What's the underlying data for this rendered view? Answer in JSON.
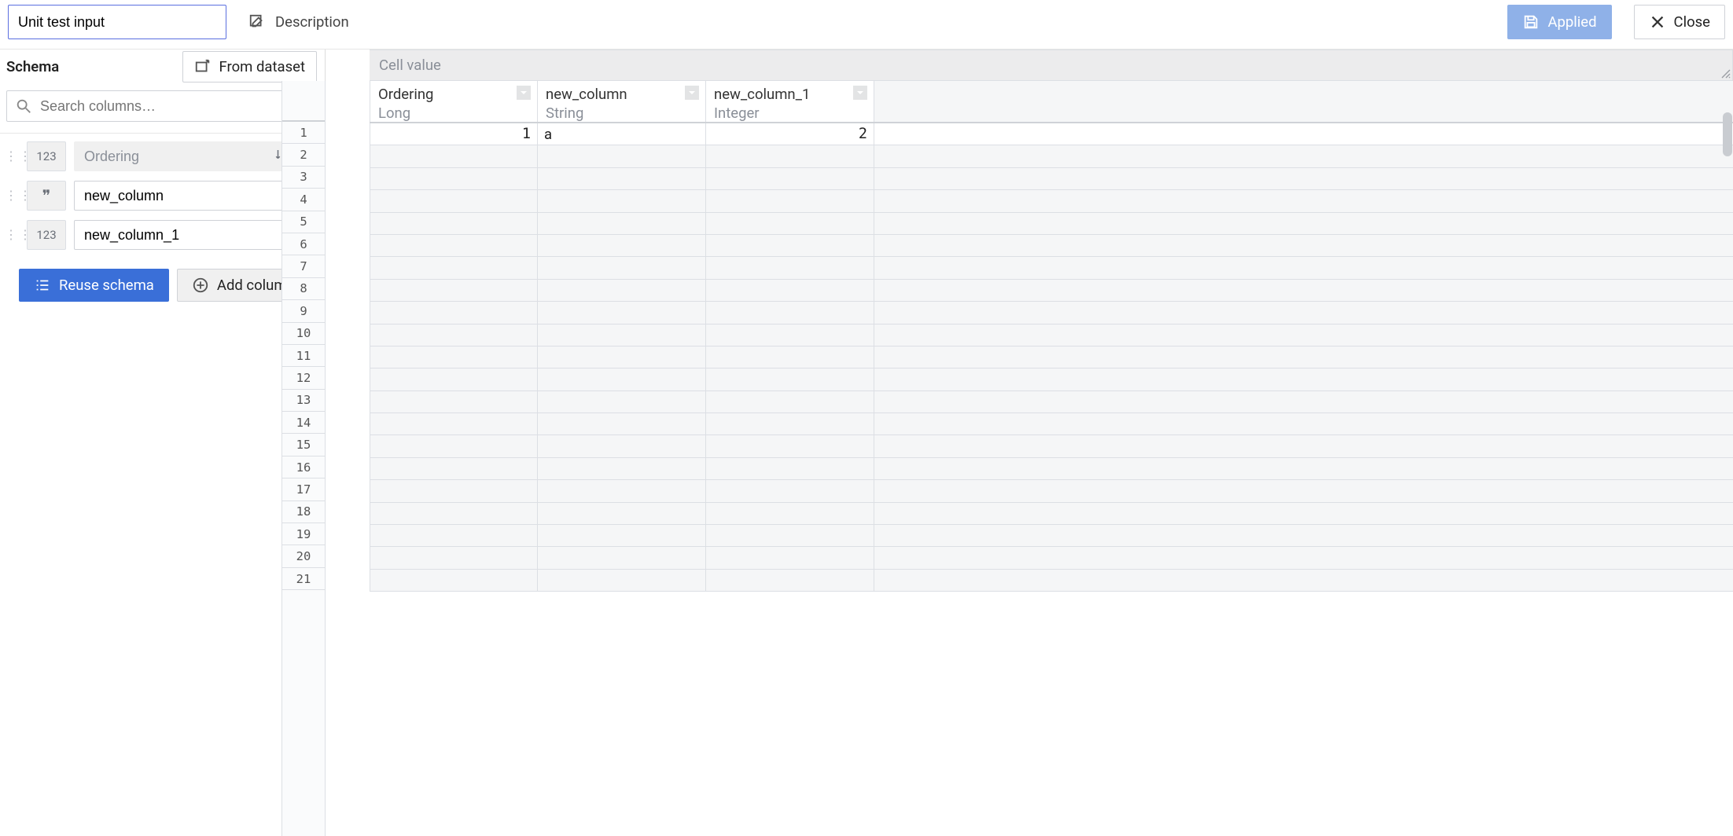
{
  "header": {
    "title_value": "Unit test input",
    "description_label": "Description",
    "applied_label": "Applied",
    "close_label": "Close"
  },
  "schema": {
    "heading": "Schema",
    "from_dataset_label": "From dataset",
    "search_placeholder": "Search columns…",
    "columns": [
      {
        "type_badge": "123",
        "name": "Ordering",
        "editable": false,
        "deletable": true,
        "show_sort": true
      },
      {
        "type_badge": "❞",
        "name": "new_column",
        "editable": true,
        "deletable": true,
        "show_sort": false
      },
      {
        "type_badge": "123",
        "name": "new_column_1",
        "editable": true,
        "deletable": true,
        "show_sort": false
      }
    ],
    "reuse_schema_label": "Reuse schema",
    "add_column_label": "Add column"
  },
  "grid": {
    "cell_value_placeholder": "Cell value",
    "columns": [
      {
        "name": "Ordering",
        "type": "Long",
        "align": "num"
      },
      {
        "name": "new_column",
        "type": "String",
        "align": "text"
      },
      {
        "name": "new_column_1",
        "type": "Integer",
        "align": "num"
      }
    ],
    "visible_row_count": 21,
    "rows": [
      {
        "values": [
          "1",
          "a",
          "2"
        ]
      }
    ]
  }
}
